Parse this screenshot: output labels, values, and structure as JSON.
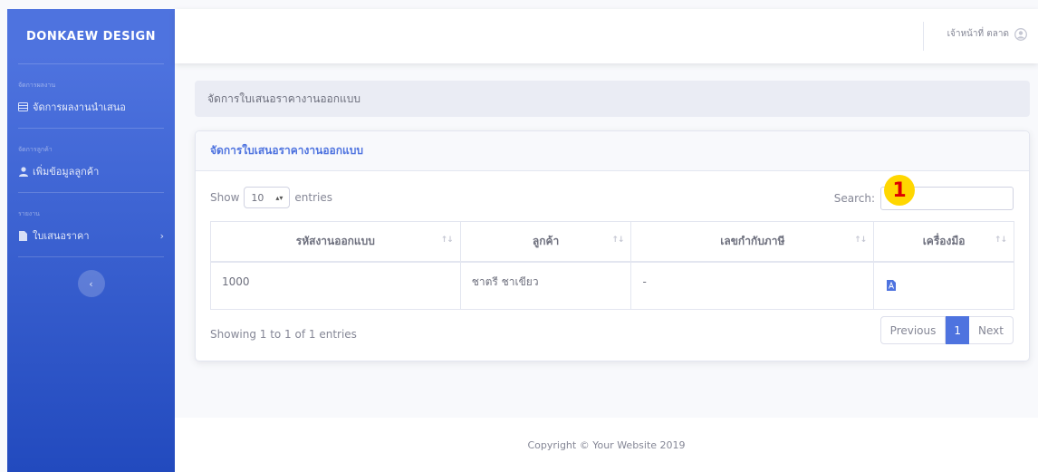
{
  "sidebar": {
    "brand": "DONKAEW DESIGN",
    "sections": [
      {
        "heading": "จัดการผลงาน",
        "item": "จัดการผลงานนำเสนอ",
        "icon": "table-icon"
      },
      {
        "heading": "จัดการลูกค้า",
        "item": "เพิ่มข้อมูลลูกค้า",
        "icon": "user-icon"
      },
      {
        "heading": "รายงาน",
        "item": "ใบเสนอราคา",
        "icon": "file-icon"
      }
    ],
    "chevron": "›",
    "toggle": "‹"
  },
  "topbar": {
    "user_name": "เจ้าหน้าที่ ตลาด",
    "user_icon": "user-circle-icon"
  },
  "breadcrumb": "จัดการใบเสนอราคางานออกแบบ",
  "card": {
    "title": "จัดการใบเสนอราคางานออกแบบ",
    "show_label": "Show",
    "length_value": "10",
    "entries_label": "entries",
    "search_label": "Search:",
    "search_value": "",
    "columns": [
      "รหัสงานออกแบบ",
      "ลูกค้า",
      "เลขกำกับภาษี",
      "เครื่องมือ"
    ],
    "sort_glyph": "↑↓",
    "rows": [
      {
        "code": "1000",
        "customer": "ชาตรี ชาเขียว",
        "tax_id": "-",
        "tool_icon": "pdf-icon"
      }
    ],
    "annotation_badge": "1",
    "info": "Showing 1 to 1 of 1 entries",
    "pagination": {
      "prev": "Previous",
      "current": "1",
      "next": "Next"
    }
  },
  "footer": "Copyright © Your Website 2019",
  "colors": {
    "primary": "#4e73df",
    "sidebar_end": "#224abe",
    "badge": "#ffd700",
    "badge_text": "#dd0000",
    "pdf": "#4e73df"
  }
}
